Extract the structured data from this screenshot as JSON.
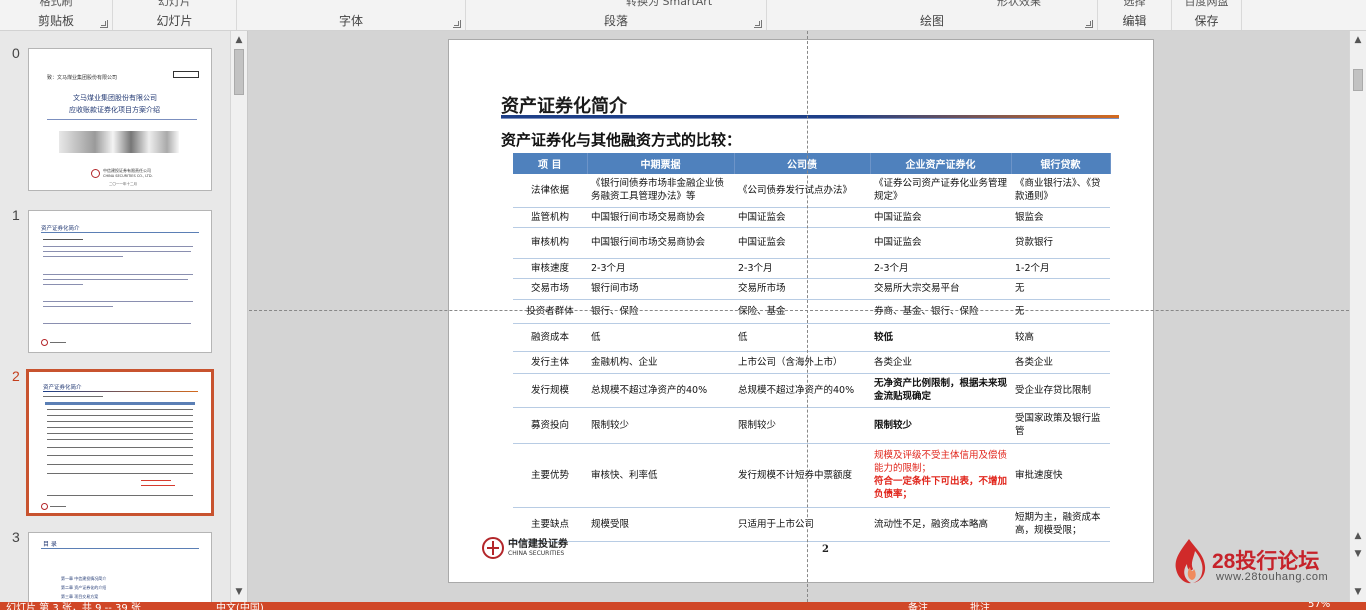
{
  "ribbon": {
    "groups": [
      {
        "label": "剪贴板",
        "top_text": "格式刷"
      },
      {
        "label": "幻灯片",
        "top_text": "幻灯片"
      },
      {
        "label": "字体",
        "top_text": ""
      },
      {
        "label": "段落",
        "top_text": "转换为 SmartArt"
      },
      {
        "label": "绘图",
        "top_text": "形状效果"
      },
      {
        "label": "编辑",
        "top_text": "选择"
      },
      {
        "label": "保存",
        "top_text": "百度网盘"
      }
    ]
  },
  "thumbnails": [
    {
      "number": "0",
      "title": "文马煤业集团股份有限公司",
      "subtitle": "应收账款证券化项目方案介绍",
      "header": "致：文马煤业集团股份有限公司",
      "company": "中信建投证券有限责任公司",
      "company_en": "CHINA SECURITIES CO., LTD.",
      "date": "二〇一一年十二月"
    },
    {
      "number": "1",
      "title": "资产证券化简介"
    },
    {
      "number": "2",
      "title": "资产证券化简介",
      "active": true
    },
    {
      "number": "3",
      "title": "目 录",
      "items": [
        "第一章  中信建投情况简介",
        "第二章  资产证券化的介绍",
        "第三章  项目交易方案"
      ]
    }
  ],
  "slide": {
    "title": "资产证券化简介",
    "subtitle": "资产证券化与其他融资方式的比较：",
    "headers": [
      "项 目",
      "中期票据",
      "公司债",
      "企业资产证券化",
      "银行贷款"
    ],
    "rows": [
      {
        "label": "法律依据",
        "cells": [
          "《银行间债券市场非金融企业债务融资工具管理办法》等",
          "《公司债券发行试点办法》",
          "《证券公司资产证券化业务管理规定》",
          "《商业银行法》、《贷款通则》"
        ]
      },
      {
        "label": "监管机构",
        "cells": [
          "中国银行间市场交易商协会",
          "中国证监会",
          "中国证监会",
          "银监会"
        ]
      },
      {
        "label": "审核机构",
        "cells": [
          "中国银行间市场交易商协会",
          "中国证监会",
          "中国证监会",
          "贷款银行"
        ]
      },
      {
        "label": "审核速度",
        "cells": [
          "2-3个月",
          "2-3个月",
          "2-3个月",
          "1-2个月"
        ]
      },
      {
        "label": "交易市场",
        "cells": [
          "银行间市场",
          "交易所市场",
          "交易所大宗交易平台",
          "无"
        ]
      },
      {
        "label": "投资者群体",
        "cells": [
          "银行、保险",
          "保险、基金",
          "券商、基金、银行、保险",
          "无"
        ]
      },
      {
        "label": "融资成本",
        "cells": [
          "低",
          "低",
          "较低",
          "较高"
        ]
      },
      {
        "label": "发行主体",
        "cells": [
          "金融机构、企业",
          "上市公司（含海外上市）",
          "各类企业",
          "各类企业"
        ]
      },
      {
        "label": "发行规模",
        "cells": [
          "总规模不超过净资产的40%",
          "总规模不超过净资产的40%",
          "无净资产比例限制，根据未来现金流贴现确定",
          "受企业存贷比限制"
        ]
      },
      {
        "label": "募资投向",
        "cells": [
          "限制较少",
          "限制较少",
          "限制较少",
          "受国家政策及银行监管"
        ]
      },
      {
        "label": "主要优势",
        "cells": [
          "审核快、利率低",
          "发行规模不计短券中票额度",
          "规模及评级不受主体信用及偿债能力的限制；",
          "审批速度快"
        ],
        "extra": "符合一定条件下可出表，不增加负债率；"
      },
      {
        "label": "主要缺点",
        "cells": [
          "规模受限",
          "只适用于上市公司",
          "流动性不足，融资成本略高",
          "短期为主，融资成本高，规模受限；"
        ]
      }
    ],
    "logo_cn": "中信建投证券",
    "logo_en": "CHINA SECURITIES",
    "page_number": "2"
  },
  "watermark": {
    "title": "28投行论坛",
    "url": "www.28touhang.com"
  },
  "statusbar": {
    "slide_info": "幻灯片 第 3 张，共 9 -- 39 张",
    "language": "中文(中国)",
    "notes": "备注",
    "comments": "批注",
    "zoom": "57%"
  },
  "colors": {
    "accent": "#d04727",
    "table_header": "#4f81bd",
    "highlight_red": "#e1261c"
  }
}
